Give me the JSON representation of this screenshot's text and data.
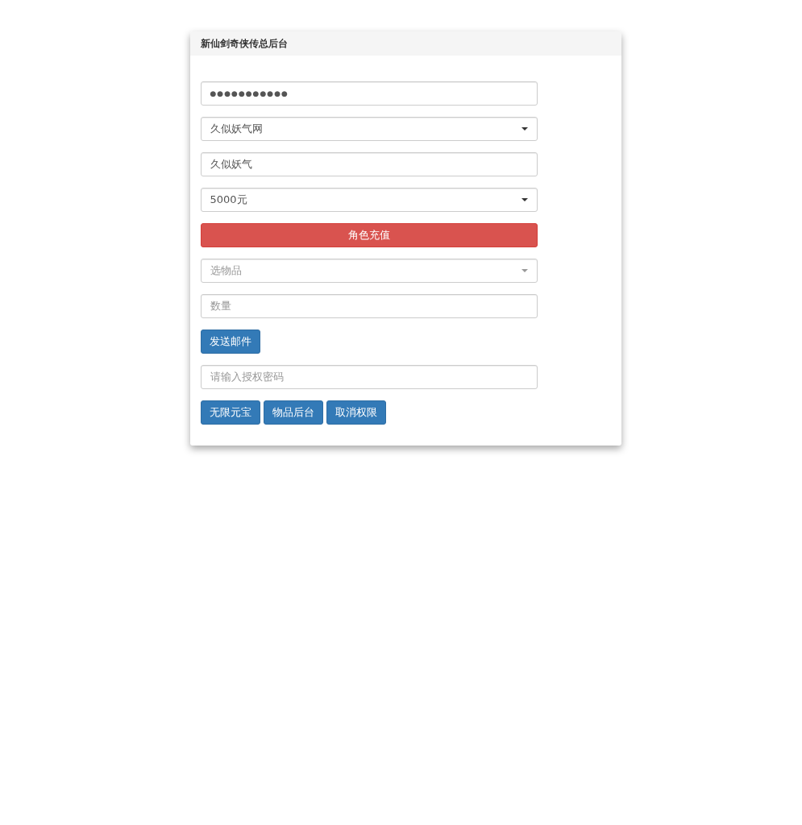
{
  "panel": {
    "title": "新仙剑奇侠传总后台"
  },
  "items": [
    {
      "kind": "password",
      "value": "●●●●●●●●●●●"
    },
    {
      "kind": "select",
      "value": "久似妖气网"
    },
    {
      "kind": "input",
      "value": "久似妖气"
    },
    {
      "kind": "select",
      "value": "5000元"
    },
    {
      "kind": "wide-button",
      "label": "角色充值"
    },
    {
      "kind": "select",
      "placeholder": "选物品"
    },
    {
      "kind": "input",
      "placeholder": "数量"
    },
    {
      "kind": "buttons",
      "buttons": [
        {
          "label": "发送邮件"
        }
      ]
    },
    {
      "kind": "input",
      "placeholder": "请输入授权密码"
    },
    {
      "kind": "buttons",
      "buttons": [
        {
          "label": "无限元宝"
        },
        {
          "label": "物品后台"
        },
        {
          "label": "取消权限"
        }
      ]
    }
  ]
}
